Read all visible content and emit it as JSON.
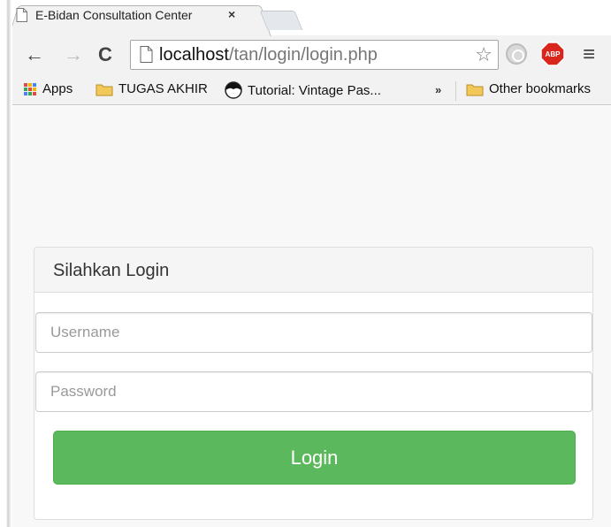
{
  "browser": {
    "tab": {
      "title": "E-Bidan Consultation Center",
      "close_glyph": "×",
      "favicon": "page-icon"
    },
    "toolbar": {
      "back_glyph": "←",
      "forward_glyph": "→",
      "reload_glyph": "C",
      "url_host": "localhost",
      "url_path": "/tan/login/login.php",
      "star_glyph": "☆",
      "menu_glyph": "≡",
      "abp_label": "ABP"
    },
    "bookmarks": {
      "apps": "Apps",
      "tugas": "TUGAS AKHIR",
      "tutorial": "Tutorial: Vintage Pas...",
      "more": "»",
      "other": "Other bookmarks"
    }
  },
  "login": {
    "heading": "Silahkan Login",
    "username_placeholder": "Username",
    "password_placeholder": "Password",
    "button_label": "Login"
  },
  "colors": {
    "button_bg": "#5cb85c",
    "abp_red": "#d9251c",
    "folder_yellow": "#f2c85b"
  }
}
